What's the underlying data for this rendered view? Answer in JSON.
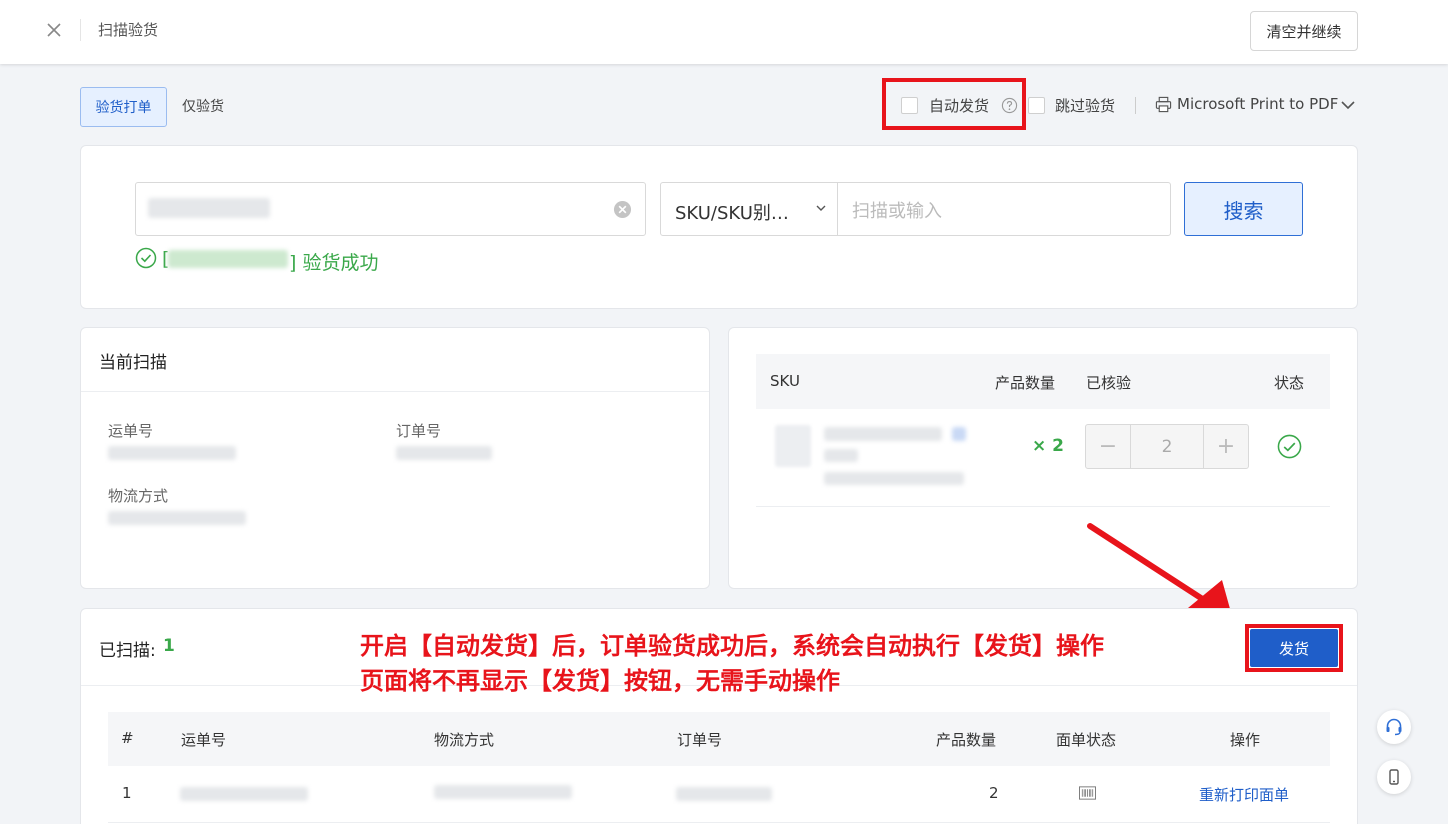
{
  "header": {
    "title": "扫描验货",
    "clear_continue": "清空并继续"
  },
  "mode_tabs": [
    {
      "label": "验货打单",
      "active": true
    },
    {
      "label": "仅验货",
      "active": false
    }
  ],
  "options": {
    "auto_ship": "自动发货",
    "skip_check": "跳过验货",
    "printer": "Microsoft Print to PDF"
  },
  "search": {
    "sku_select": "SKU/SKU别…",
    "sku_placeholder": "扫描或输入",
    "button": "搜索",
    "bracket_open": "[",
    "success_suffix": "] 验货成功"
  },
  "current_scan": {
    "title": "当前扫描",
    "waybill_label": "运单号",
    "order_label": "订单号",
    "logistics_label": "物流方式"
  },
  "sku_table": {
    "headers": [
      "SKU",
      "产品数量",
      "已核验",
      "状态"
    ],
    "row": {
      "qty": "× 2",
      "verified": "2",
      "minus": "−",
      "plus": "+"
    }
  },
  "scanned": {
    "label": "已扫描: ",
    "count": "1",
    "ship_button": "发货",
    "headers": [
      "#",
      "运单号",
      "物流方式",
      "订单号",
      "产品数量",
      "面单状态",
      "操作"
    ],
    "rows": [
      {
        "index": "1",
        "qty": "2",
        "action": "重新打印面单"
      }
    ]
  },
  "annotation": {
    "line1": "开启【自动发货】后，订单验货成功后，系统会自动执行【发货】操作",
    "line2": "页面将不再显示【发货】按钮，无需手动操作"
  },
  "colors": {
    "accent": "#1f5ec9",
    "success": "#3aa84a",
    "annotation_red": "#e8141b"
  }
}
